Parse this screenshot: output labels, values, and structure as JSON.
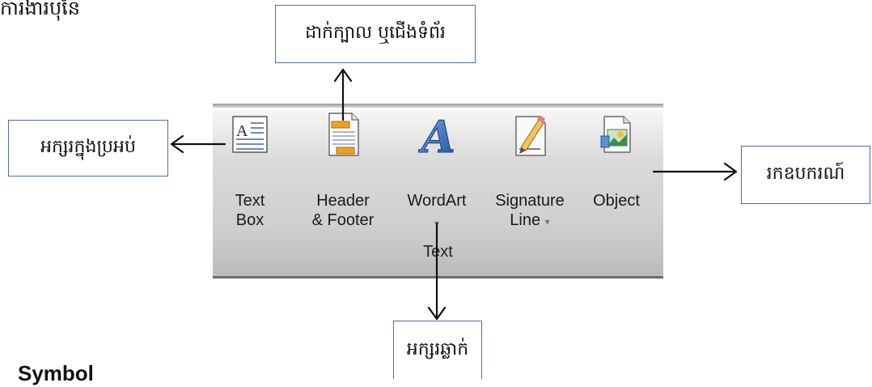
{
  "top_cut_text": "ការងារបុនែ",
  "callouts": {
    "header": "ដាក់ក្បាល ឬជើងទំព័រ",
    "textbox": "អក្សរក្នុងប្រអប់",
    "object": "រកឧបករណ៍",
    "wordart": "អក្សរឆ្លាក់"
  },
  "ribbon": {
    "buttons": [
      {
        "icon": "text-box-icon",
        "label_line1": "Text",
        "label_line2": "Box"
      },
      {
        "icon": "header-footer-icon",
        "label_line1": "Header",
        "label_line2": "& Footer"
      },
      {
        "icon": "wordart-icon",
        "label_line1": "WordArt",
        "dropdown": "▾"
      },
      {
        "icon": "signature-line-icon",
        "label_line1": "Signature",
        "label_line2": "Line",
        "dropdown": "▾"
      },
      {
        "icon": "object-icon",
        "label_line1": "Object"
      }
    ],
    "group_label": "Text"
  },
  "bottom_heading": "Symbol"
}
